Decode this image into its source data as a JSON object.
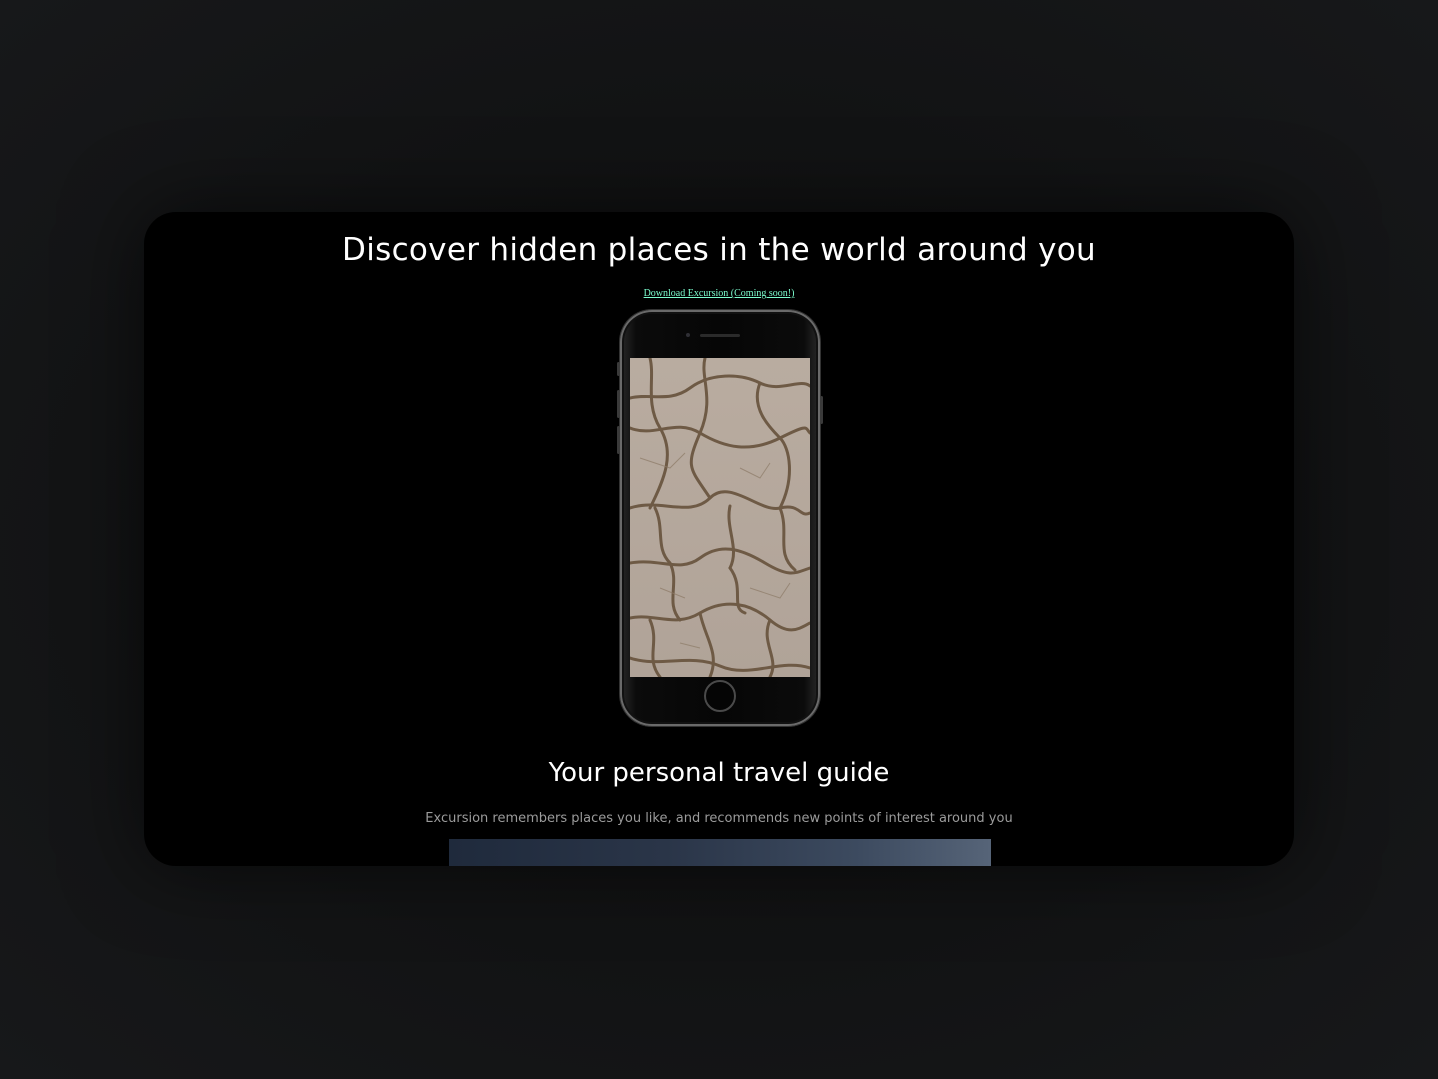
{
  "hero": {
    "headline": "Discover hidden places in the world around you",
    "download_link": "Download Excursion (Coming soon!)"
  },
  "phone": {
    "screen_image": "cracked-dry-earth"
  },
  "feature": {
    "title": "Your personal travel guide",
    "description": "Excursion remembers places you like, and recommends new points of interest around you",
    "image": "night-sky-photo"
  },
  "colors": {
    "background": "#121314",
    "card": "#000000",
    "link": "#7dffd0",
    "headline": "#ffffff",
    "description": "#9b9b9b"
  }
}
